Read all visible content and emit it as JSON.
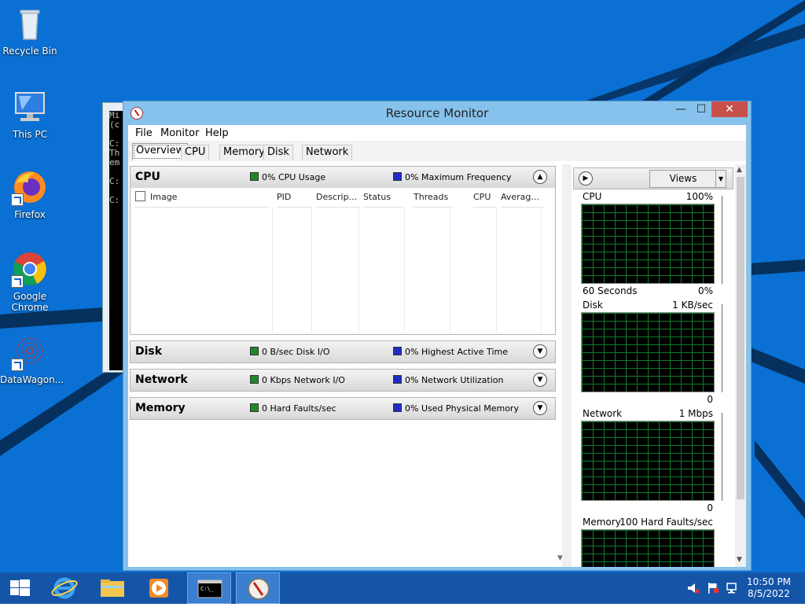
{
  "desktop": {
    "icons": [
      {
        "label": "Recycle Bin"
      },
      {
        "label": "This PC"
      },
      {
        "label": "Firefox"
      },
      {
        "label": "Google Chrome"
      },
      {
        "label": "DataWagon..."
      }
    ],
    "background_color": "#0a6fd1"
  },
  "cmd_window": {
    "lines": "Mi\n(c\n\nC:\nTh\nem\n\nC:\n\nC:"
  },
  "window": {
    "title": "Resource Monitor",
    "close_glyph": "✕",
    "max_glyph": "☐",
    "min_glyph": "—",
    "menu": [
      "File",
      "Monitor",
      "Help"
    ],
    "tabs": [
      "Overview",
      "CPU",
      "Memory",
      "Disk",
      "Network"
    ],
    "active_tab": "Overview"
  },
  "sections": {
    "cpu": {
      "name": "CPU",
      "metric1": "0% CPU Usage",
      "metric2": "0% Maximum Frequency",
      "expanded": true
    },
    "disk": {
      "name": "Disk",
      "metric1": "0 B/sec Disk I/O",
      "metric2": "0% Highest Active Time",
      "expanded": false
    },
    "network": {
      "name": "Network",
      "metric1": "0 Kbps Network I/O",
      "metric2": "0% Network Utilization",
      "expanded": false
    },
    "memory": {
      "name": "Memory",
      "metric1": "0 Hard Faults/sec",
      "metric2": "0% Used Physical Memory",
      "expanded": false
    }
  },
  "cpu_table": {
    "columns": [
      "Image",
      "PID",
      "Descrip...",
      "Status",
      "Threads",
      "CPU",
      "Averag..."
    ]
  },
  "right_pane": {
    "views_label": "Views",
    "graphs": [
      {
        "name": "CPU",
        "max": "100%",
        "footer_left": "60 Seconds",
        "footer_right": "0%"
      },
      {
        "name": "Disk",
        "max": "1 KB/sec",
        "footer_left": "",
        "footer_right": "0"
      },
      {
        "name": "Network",
        "max": "1 Mbps",
        "footer_left": "",
        "footer_right": "0"
      },
      {
        "name": "Memory",
        "max": "100 Hard Faults/sec",
        "footer_left": "",
        "footer_right": ""
      }
    ]
  },
  "taskbar": {
    "clock_time": "10:50 PM",
    "clock_date": "8/5/2022",
    "color": "#1455a8"
  }
}
